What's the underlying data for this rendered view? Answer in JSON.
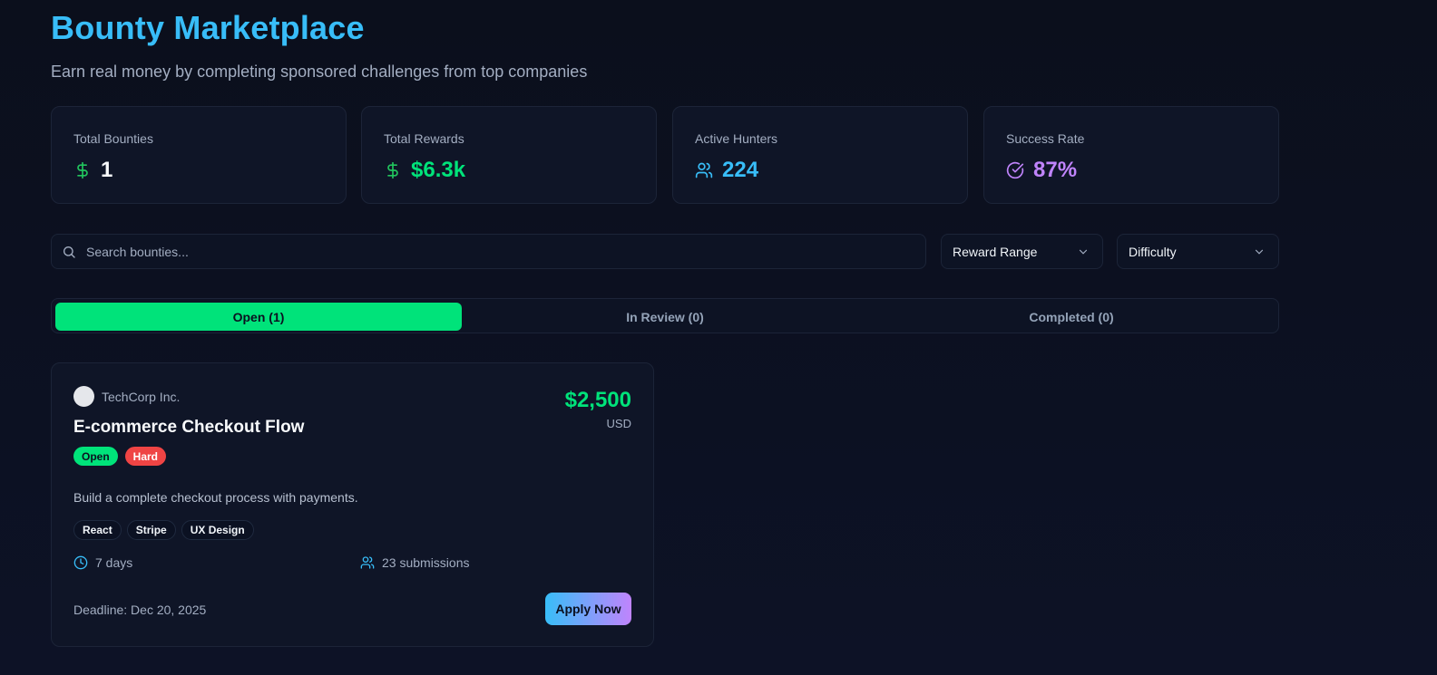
{
  "header": {
    "title": "Bounty Marketplace",
    "subtitle": "Earn real money by completing sponsored challenges from top companies"
  },
  "stats": [
    {
      "label": "Total Bounties",
      "value": "1",
      "icon": "dollar-icon",
      "color": "#f8fafc",
      "icon_color": "#22c55e"
    },
    {
      "label": "Total Rewards",
      "value": "$6.3k",
      "icon": "dollar-icon",
      "color": "#00e37a",
      "icon_color": "#22c55e"
    },
    {
      "label": "Active Hunters",
      "value": "224",
      "icon": "users-icon",
      "color": "#38bdf8",
      "icon_color": "#38bdf8"
    },
    {
      "label": "Success Rate",
      "value": "87%",
      "icon": "check-circle-icon",
      "color": "#c084fc",
      "icon_color": "#c084fc"
    }
  ],
  "filters": {
    "search_placeholder": "Search bounties...",
    "reward_range": "Reward Range",
    "difficulty": "Difficulty"
  },
  "tabs": [
    {
      "label": "Open (1)",
      "active": true
    },
    {
      "label": "In Review (0)",
      "active": false
    },
    {
      "label": "Completed (0)",
      "active": false
    }
  ],
  "bounty": {
    "company": "TechCorp Inc.",
    "title": "E-commerce Checkout Flow",
    "status": "Open",
    "difficulty": "Hard",
    "reward": "$2,500",
    "currency": "USD",
    "description": "Build a complete checkout process with payments.",
    "tags": [
      "React",
      "Stripe",
      "UX Design"
    ],
    "duration": "7 days",
    "submissions": "23 submissions",
    "deadline": "Deadline: Dec 20, 2025",
    "apply_label": "Apply Now"
  },
  "colors": {
    "accent": "#38bdf8",
    "success": "#00e37a",
    "danger": "#ef4444",
    "purple": "#c084fc",
    "background": "#0b1020"
  }
}
